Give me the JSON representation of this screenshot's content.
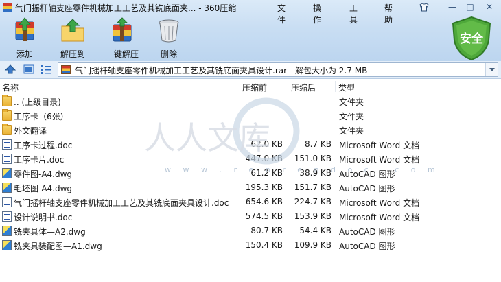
{
  "window": {
    "title": "气门摇杆轴支座零件机械加工工艺及其铣底面夹...  - 360压缩",
    "menus": [
      "文件",
      "操作",
      "工具",
      "帮助"
    ],
    "controls": {
      "minimize": "—",
      "maximize": "□",
      "close": "✕"
    }
  },
  "toolbar": {
    "add": "添加",
    "extract_to": "解压到",
    "one_click_extract": "一键解压",
    "delete": "删除",
    "security_badge": "安全"
  },
  "addressbar": {
    "path": "气门摇杆轴支座零件机械加工工艺及其铣底面夹具设计.rar - 解包大小为 2.7 MB"
  },
  "columns": {
    "name": "名称",
    "size": "压缩前",
    "packed": "压缩后",
    "type": "类型"
  },
  "files": [
    {
      "icon": "folder",
      "name": ".. (上级目录)",
      "size": "",
      "packed": "",
      "type": "文件夹"
    },
    {
      "icon": "folder",
      "name": "工序卡（6张）",
      "size": "",
      "packed": "",
      "type": "文件夹"
    },
    {
      "icon": "folder",
      "name": "外文翻译",
      "size": "",
      "packed": "",
      "type": "文件夹"
    },
    {
      "icon": "doc",
      "name": "工序卡过程.doc",
      "size": "62.0 KB",
      "packed": "8.7 KB",
      "type": "Microsoft Word 文档"
    },
    {
      "icon": "doc",
      "name": "工序卡片.doc",
      "size": "447.0 KB",
      "packed": "151.0 KB",
      "type": "Microsoft Word 文档"
    },
    {
      "icon": "dwg",
      "name": "零件图-A4.dwg",
      "size": "61.2 KB",
      "packed": "38.9 KB",
      "type": "AutoCAD 图形"
    },
    {
      "icon": "dwg",
      "name": "毛坯图-A4.dwg",
      "size": "195.3 KB",
      "packed": "151.7 KB",
      "type": "AutoCAD 图形"
    },
    {
      "icon": "doc",
      "name": "气门摇杆轴支座零件机械加工工艺及其铣底面夹具设计.doc",
      "size": "654.6 KB",
      "packed": "224.7 KB",
      "type": "Microsoft Word 文档"
    },
    {
      "icon": "doc",
      "name": "设计说明书.doc",
      "size": "574.5 KB",
      "packed": "153.9 KB",
      "type": "Microsoft Word 文档"
    },
    {
      "icon": "dwg",
      "name": "铣夹具体—A2.dwg",
      "size": "80.7 KB",
      "packed": "54.4 KB",
      "type": "AutoCAD 图形"
    },
    {
      "icon": "dwg",
      "name": "铣夹具装配图—A1.dwg",
      "size": "150.4 KB",
      "packed": "109.9 KB",
      "type": "AutoCAD 图形"
    }
  ],
  "watermark": {
    "text": "人人文库",
    "url": "w w w . r e n r e n d o c . c o m"
  },
  "colors": {
    "chrome_top": "#dbeaf8",
    "chrome_bottom": "#bcd5ef",
    "shield_green": "#4ea83a"
  }
}
